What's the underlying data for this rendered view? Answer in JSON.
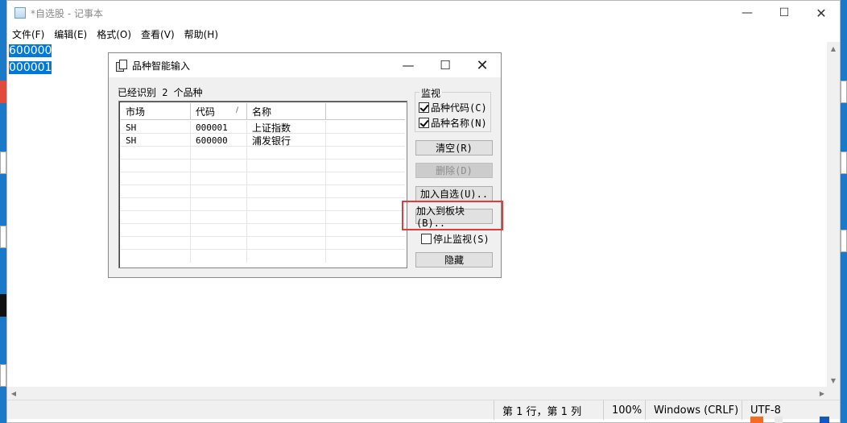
{
  "notepad": {
    "title": "*自选股 - 记事本",
    "window_controls": {
      "minimize": "—",
      "maximize": "☐",
      "close": "✕"
    },
    "menu": [
      "文件(F)",
      "编辑(E)",
      "格式(O)",
      "查看(V)",
      "帮助(H)"
    ],
    "lines": [
      "600000",
      "000001"
    ],
    "status": {
      "position": "第 1 行，第 1 列",
      "zoom": "100%",
      "line_ending": "Windows (CRLF)",
      "encoding": "UTF-8"
    }
  },
  "dialog": {
    "title": "品种智能输入",
    "window_controls": {
      "minimize": "—",
      "maximize": "☐",
      "close": "✕"
    },
    "count_text": "已经识别 2 个品种",
    "columns": [
      "市场",
      "代码",
      "名称"
    ],
    "sort_indicator": "/",
    "rows": [
      {
        "market": "SH",
        "code": "000001",
        "name": "上证指数"
      },
      {
        "market": "SH",
        "code": "600000",
        "name": "浦发银行"
      }
    ],
    "monitor_group": "监视",
    "checks": [
      {
        "label": "品种代码(C)",
        "checked": true
      },
      {
        "label": "品种名称(N)",
        "checked": true
      }
    ],
    "buttons": {
      "clear": "清空(R)",
      "delete": "删除(D)",
      "add_watch": "加入自选(U)..",
      "add_block": "加入到板块(B)..",
      "hide": "隐藏"
    },
    "stop_monitor": {
      "label": "停止监视(S)",
      "checked": false
    },
    "highlight_color": "#e23b3b"
  }
}
